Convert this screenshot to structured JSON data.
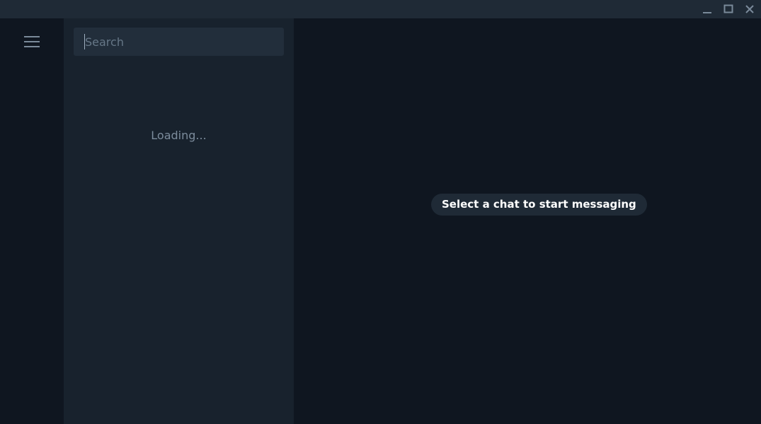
{
  "window": {
    "controls": {
      "minimize_icon": "minimize-icon",
      "maximize_icon": "maximize-icon",
      "close_icon": "close-icon"
    }
  },
  "rail": {
    "menu_icon": "hamburger-menu-icon"
  },
  "chatlist": {
    "search": {
      "placeholder": "Search",
      "value": ""
    },
    "status_text": "Loading..."
  },
  "main": {
    "empty_state_text": "Select a chat to start messaging"
  },
  "colors": {
    "titlebar_bg": "#1f2a36",
    "rail_bg": "#0f1620",
    "chatlist_bg": "#18222d",
    "search_bg": "#222e3b",
    "main_bg": "#0f1620",
    "pill_bg": "#1f2a36",
    "icon_color": "#7a8a9a"
  }
}
